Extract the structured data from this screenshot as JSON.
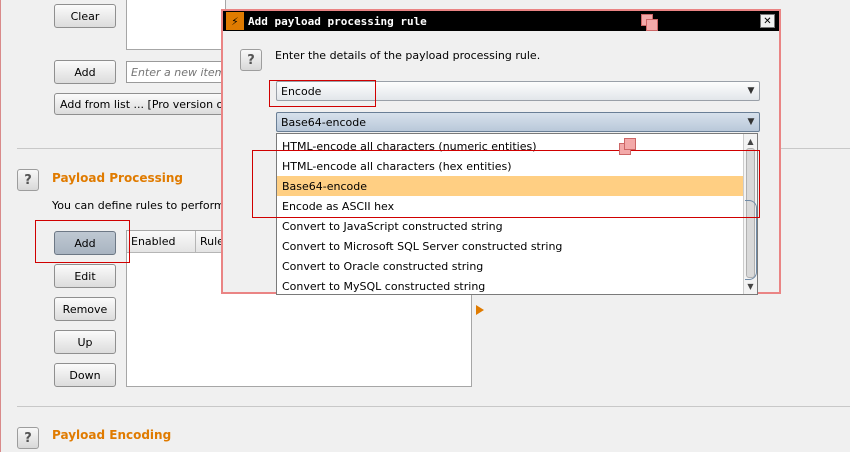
{
  "background": {
    "clear_button": "Clear",
    "add_button_top": "Add",
    "new_item_placeholder": "Enter a new item",
    "add_from_list": "Add from list ... [Pro version only]",
    "payload_processing": {
      "title": "Payload Processing",
      "description": "You can define rules to perform va",
      "buttons": [
        "Add",
        "Edit",
        "Remove",
        "Up",
        "Down"
      ],
      "columns": [
        "Enabled",
        "Rule"
      ]
    },
    "payload_encoding_title": "Payload Encoding",
    "help_glyph": "?"
  },
  "dialog": {
    "title": "Add payload processing rule",
    "close_glyph": "✕",
    "description": "Enter the details of the payload processing rule.",
    "rule_type": "Encode",
    "encoding_selected": "Base64-encode",
    "options": [
      "HTML-encode all characters (numeric entities)",
      "HTML-encode all characters (hex entities)",
      "Base64-encode",
      "Encode as ASCII hex",
      "Convert to JavaScript constructed string",
      "Convert to Microsoft SQL Server constructed string",
      "Convert to Oracle constructed string",
      "Convert to MySQL constructed string"
    ],
    "highlighted_option": "Base64-encode"
  },
  "icons": [
    "burp-logo-icon",
    "close-icon",
    "help-icon",
    "dropdown-arrow-icon",
    "play-arrow-icon"
  ],
  "colors": {
    "accent": "#e07b00",
    "highlight": "#ffcf83",
    "annotation": "#d00000",
    "titlebar": "#000000"
  }
}
